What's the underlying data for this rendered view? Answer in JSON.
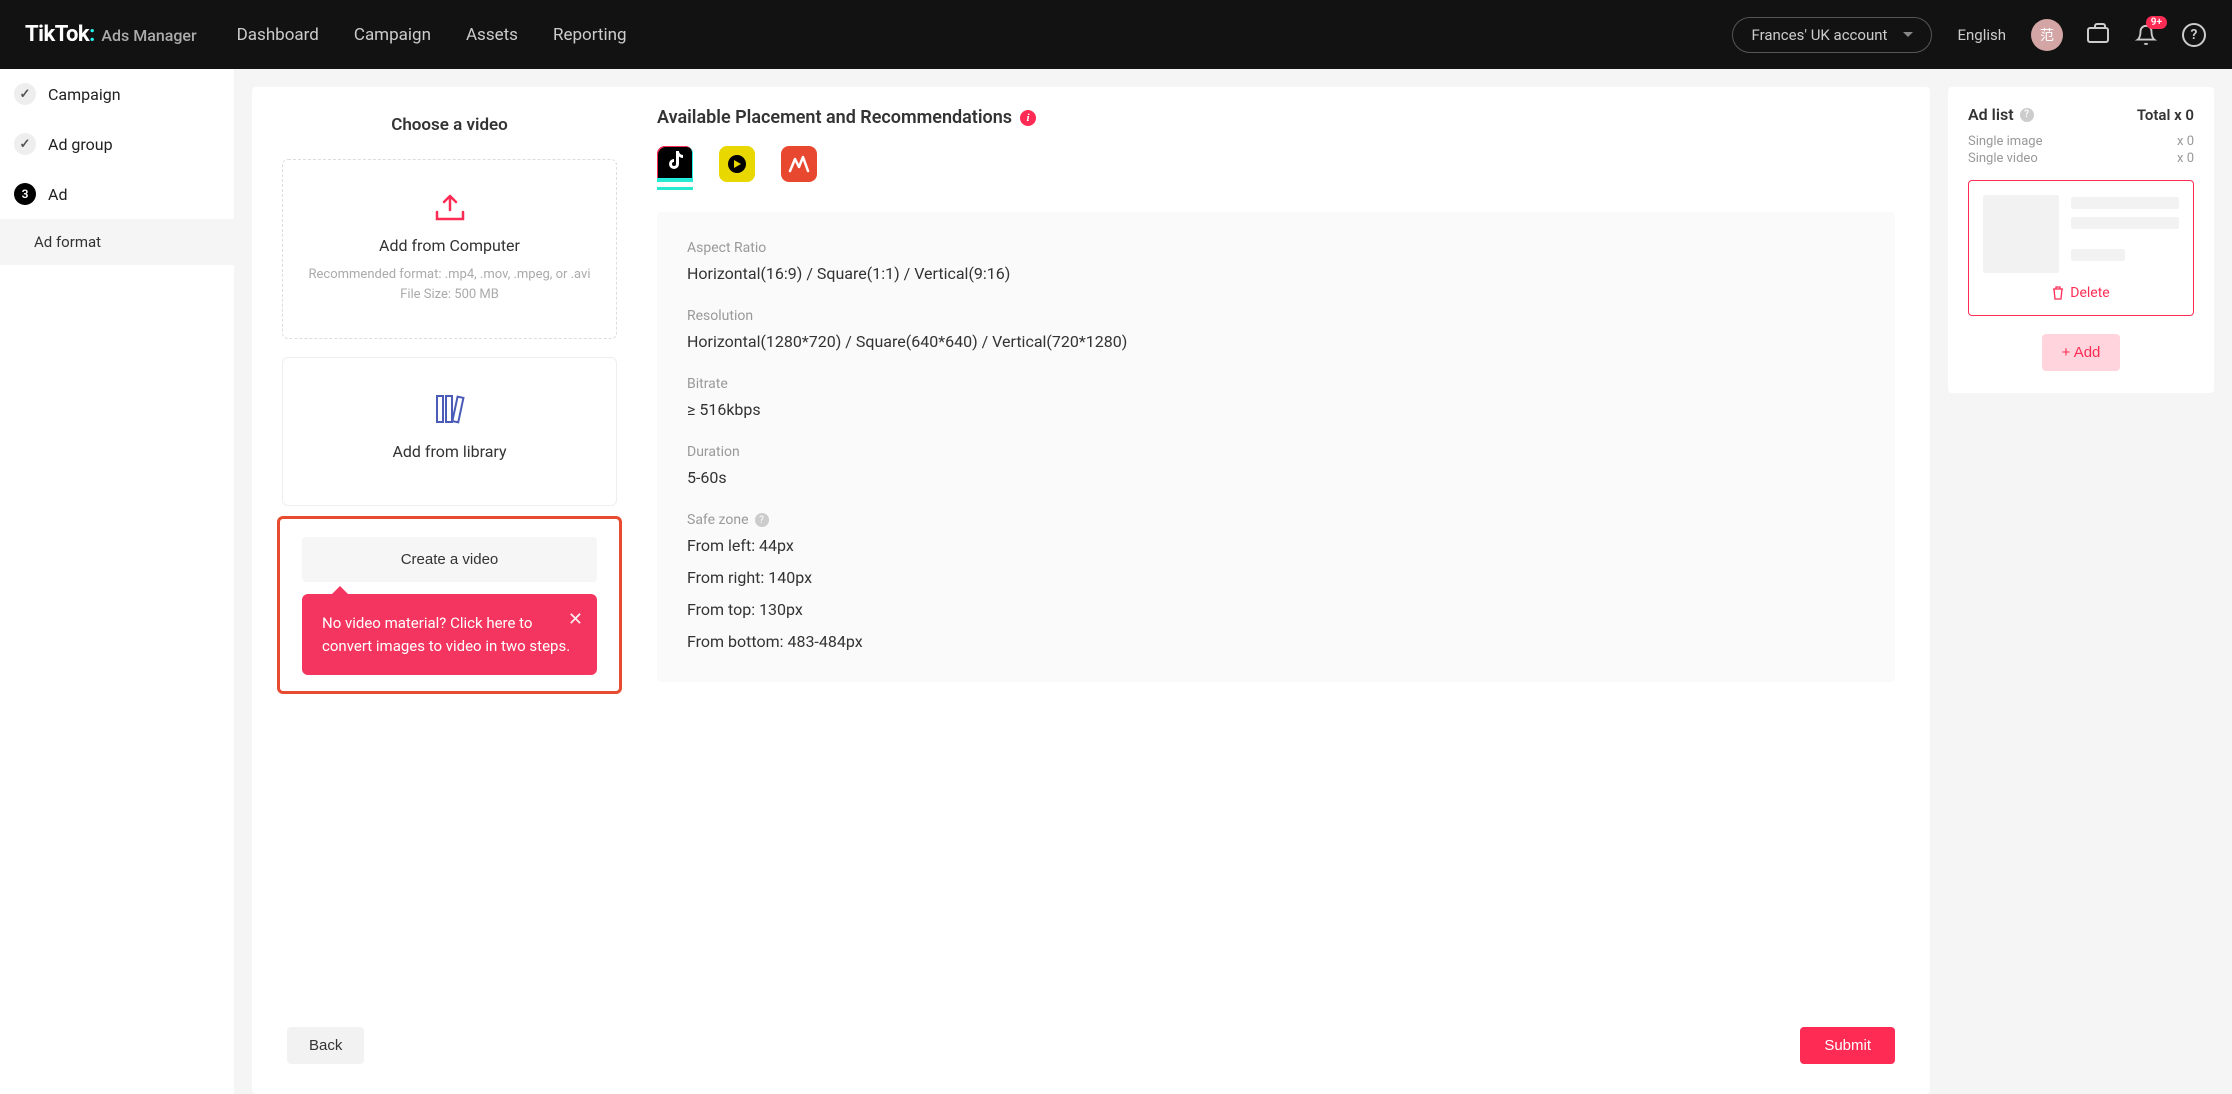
{
  "topnav": {
    "logo_main": "TikTok",
    "logo_sub": "Ads Manager",
    "items": [
      "Dashboard",
      "Campaign",
      "Assets",
      "Reporting"
    ],
    "account": "Frances' UK account",
    "language": "English",
    "avatar_char": "范",
    "notif_badge": "9+"
  },
  "sidebar": {
    "steps": [
      {
        "label": "Campaign",
        "done": true
      },
      {
        "label": "Ad group",
        "done": true
      },
      {
        "label": "Ad",
        "num": "3"
      }
    ],
    "sub": "Ad format"
  },
  "choose": {
    "title": "Choose a video",
    "upload_title": "Add from Computer",
    "upload_hint1": "Recommended format: .mp4, .mov, .mpeg, or .avi",
    "upload_hint2": "File Size: 500 MB",
    "library_title": "Add from library",
    "create_btn": "Create a video",
    "tooltip": "No video material? Click here to convert images to video in two steps."
  },
  "placement": {
    "title": "Available Placement and Recommendations",
    "specs": {
      "aspect_label": "Aspect Ratio",
      "aspect_val": "Horizontal(16:9) / Square(1:1) / Vertical(9:16)",
      "res_label": "Resolution",
      "res_val": "Horizontal(1280*720) / Square(640*640) / Vertical(720*1280)",
      "bitrate_label": "Bitrate",
      "bitrate_val": "≥ 516kbps",
      "duration_label": "Duration",
      "duration_val": "5-60s",
      "safezone_label": "Safe zone",
      "sz_left": "From left: 44px",
      "sz_right": "From right: 140px",
      "sz_top": "From top: 130px",
      "sz_bottom": "From bottom: 483-484px"
    }
  },
  "footer": {
    "back": "Back",
    "submit": "Submit"
  },
  "adlist": {
    "title": "Ad list",
    "total": "Total x 0",
    "rows": [
      {
        "label": "Single image",
        "count": "x 0"
      },
      {
        "label": "Single video",
        "count": "x 0"
      }
    ],
    "delete": "Delete",
    "add": "+ Add"
  }
}
